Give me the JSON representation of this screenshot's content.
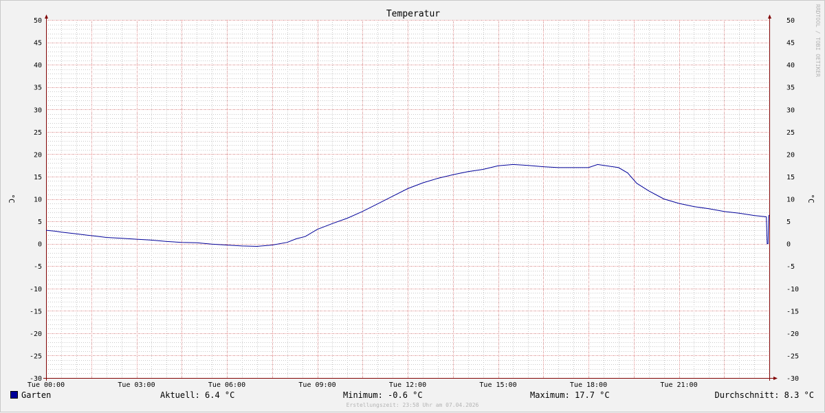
{
  "watermark": "RRDTOOL / TOBI OETIKER",
  "legend": {
    "series_name": "Garten",
    "series_color": "#000099",
    "current": "Aktuell: 6.4 °C",
    "minimum": "Minimum: -0.6 °C",
    "maximum": "Maximum: 17.7 °C",
    "average": "Durchschnitt: 8.3 °C"
  },
  "created": "Erstellungszeit: 23:58 Uhr am 07.04.2026",
  "colors": {
    "background": "#f2f2f2",
    "canvas": "#ffffff",
    "major_grid": "#f0a0a0",
    "minor_grid": "#c8c8c8",
    "axis": "#800000",
    "line": "#000099"
  },
  "chart_data": {
    "type": "line",
    "title": "Temperatur",
    "ylabel": "°C",
    "ylabel_right": "°C",
    "xlim": [
      0,
      24
    ],
    "ylim": [
      -30,
      50
    ],
    "grid": true,
    "legend_position": "bottom",
    "xticks": [
      0,
      3,
      6,
      9,
      12,
      15,
      18,
      21
    ],
    "xtick_labels": [
      "Tue 00:00",
      "Tue 03:00",
      "Tue 06:00",
      "Tue 09:00",
      "Tue 12:00",
      "Tue 15:00",
      "Tue 18:00",
      "Tue 21:00"
    ],
    "yticks": [
      -30,
      -25,
      -20,
      -15,
      -10,
      -5,
      0,
      5,
      10,
      15,
      20,
      25,
      30,
      35,
      40,
      45,
      50
    ],
    "series": [
      {
        "name": "Garten",
        "color": "#000099",
        "x": [
          0,
          0.3,
          0.5,
          1,
          1.5,
          2,
          2.5,
          3,
          3.5,
          4,
          4.5,
          5,
          5.5,
          6,
          6.5,
          7,
          7.5,
          8,
          8.3,
          8.6,
          9,
          9.5,
          10,
          10.5,
          11,
          11.5,
          12,
          12.5,
          13,
          13.5,
          14,
          14.5,
          15,
          15.5,
          16,
          16.5,
          17,
          17.5,
          18,
          18.3,
          18.6,
          19,
          19.3,
          19.6,
          20,
          20.5,
          21,
          21.5,
          22,
          22.5,
          23,
          23.5,
          23.9,
          23.93,
          23.96,
          23.98,
          24
        ],
        "y": [
          3.0,
          2.8,
          2.6,
          2.2,
          1.8,
          1.4,
          1.2,
          1.0,
          0.8,
          0.5,
          0.3,
          0.2,
          -0.1,
          -0.3,
          -0.5,
          -0.6,
          -0.3,
          0.3,
          1.1,
          1.6,
          3.2,
          4.5,
          5.7,
          7.2,
          8.9,
          10.6,
          12.3,
          13.6,
          14.6,
          15.4,
          16.1,
          16.6,
          17.4,
          17.7,
          17.5,
          17.2,
          17.0,
          17.0,
          17.0,
          17.7,
          17.4,
          17.0,
          15.8,
          13.5,
          11.8,
          10.0,
          9.0,
          8.3,
          7.8,
          7.2,
          6.8,
          6.3,
          6.0,
          0.0,
          0.0,
          6.2,
          6.4
        ]
      }
    ]
  }
}
